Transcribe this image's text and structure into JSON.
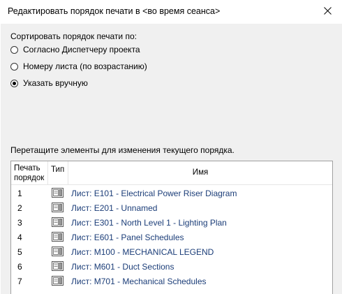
{
  "window": {
    "title": "Редактировать порядок печати в <во время сеанса>"
  },
  "sort": {
    "label": "Сортировать порядок печати по:",
    "options": [
      {
        "label": "Согласно Диспетчеру проекта",
        "checked": false
      },
      {
        "label": "Номеру листа (по возрастанию)",
        "checked": false
      },
      {
        "label": "Указать вручную",
        "checked": true
      }
    ]
  },
  "list": {
    "instruction": "Перетащите элементы для изменения текущего порядка.",
    "headers": {
      "order_line1": "Печать",
      "order_line2": "порядок",
      "type": "Тип",
      "name": "Имя"
    },
    "rows": [
      {
        "order": "1",
        "icon": "sheet-icon",
        "name": "Лист: E101 - Electrical Power Riser Diagram"
      },
      {
        "order": "2",
        "icon": "sheet-icon",
        "name": "Лист: E201 - Unnamed"
      },
      {
        "order": "3",
        "icon": "sheet-icon",
        "name": "Лист: E301 - North Level 1 - Lighting Plan"
      },
      {
        "order": "4",
        "icon": "sheet-icon",
        "name": "Лист: E601 - Panel Schedules"
      },
      {
        "order": "5",
        "icon": "sheet-icon",
        "name": "Лист: M100 - MECHANICAL LEGEND"
      },
      {
        "order": "6",
        "icon": "sheet-icon",
        "name": "Лист: M601 - Duct Sections"
      },
      {
        "order": "7",
        "icon": "sheet-icon",
        "name": "Лист: M701 - Mechanical Schedules"
      }
    ]
  },
  "colors": {
    "link_text": "#1b3d78",
    "dialog_bg": "#f0f0f0"
  }
}
